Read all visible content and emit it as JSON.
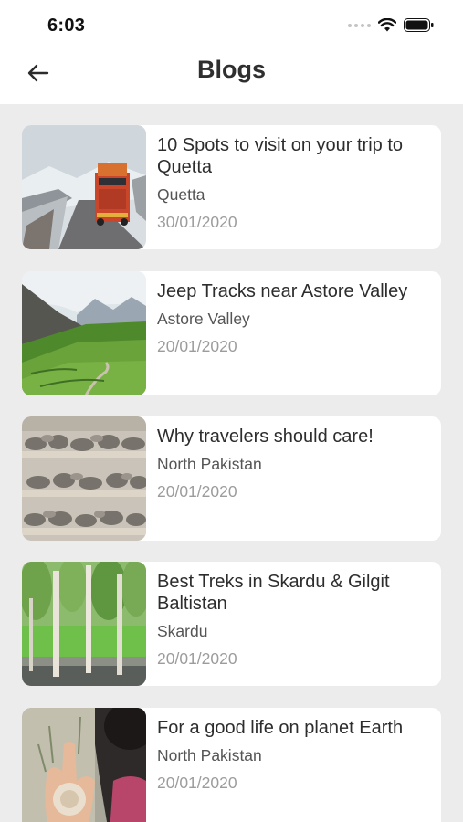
{
  "status": {
    "time": "6:03"
  },
  "header": {
    "title": "Blogs"
  },
  "blogs": [
    {
      "title": "10 Spots to visit on your trip to Quetta",
      "location": "Quetta",
      "date": "30/01/2020",
      "image": "truck-on-snowy-road"
    },
    {
      "title": "Jeep Tracks near Astore Valley",
      "location": "Astore Valley",
      "date": "20/01/2020",
      "image": "green-mountain-valley"
    },
    {
      "title": "Why travelers should care!",
      "location": "North Pakistan",
      "date": "20/01/2020",
      "image": "stone-wall-shelves"
    },
    {
      "title": "Best Treks in Skardu & Gilgit Baltistan",
      "location": "Skardu",
      "date": "20/01/2020",
      "image": "poplar-trees-field"
    },
    {
      "title": "For a good life on planet Earth",
      "location": "North Pakistan",
      "date": "20/01/2020",
      "image": "hand-with-flower"
    }
  ]
}
